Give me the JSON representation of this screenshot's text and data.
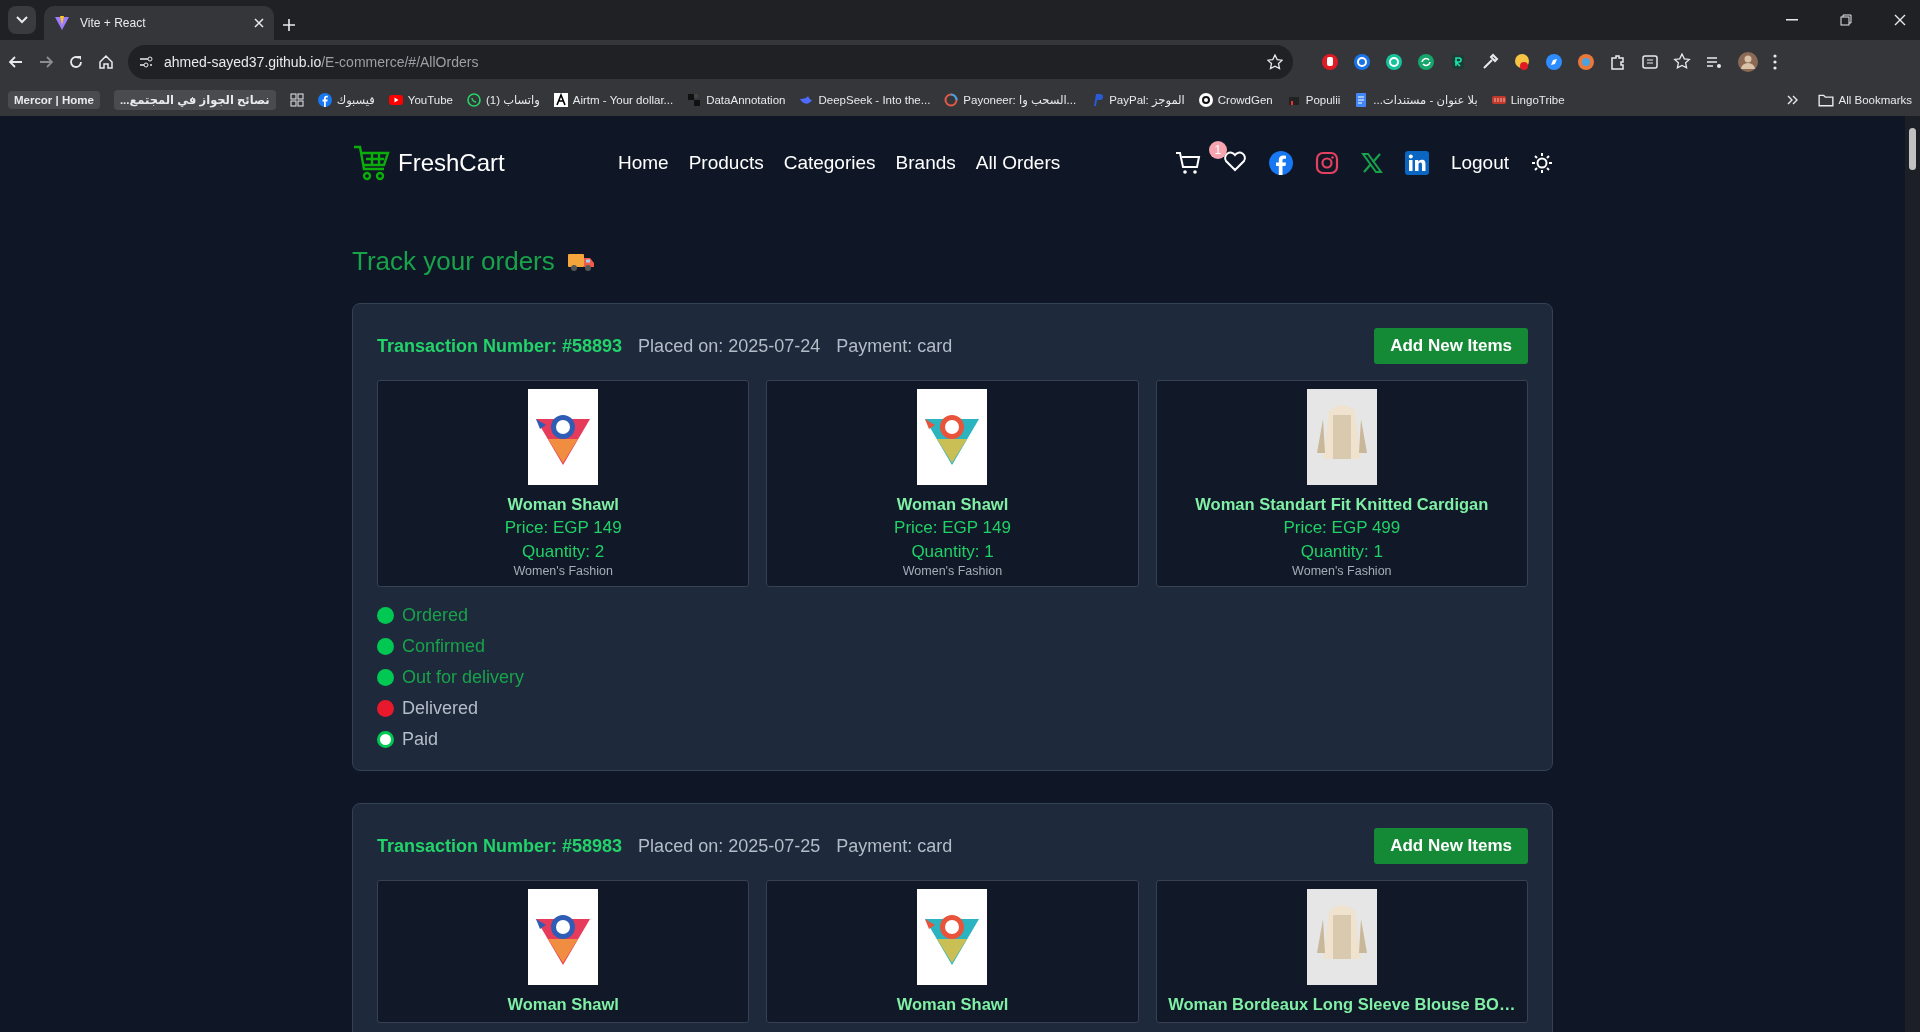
{
  "browser": {
    "tab_title": "Vite + React",
    "url_host": "ahmed-sayed37.github.io",
    "url_path": "/E-commerce/#/AllOrders",
    "bookmarks": [
      {
        "label": "Mercor | Home",
        "kind": "chip"
      },
      {
        "label": "نصائح الجواز في المجتمع...",
        "kind": "chip"
      },
      {
        "kind": "apps"
      },
      {
        "label": "فيسبوك",
        "kind": "facebook"
      },
      {
        "label": "YouTube",
        "kind": "youtube"
      },
      {
        "label": "واتساب (1)",
        "kind": "whatsapp"
      },
      {
        "label": "Airtm - Your dollar...",
        "kind": "airtm"
      },
      {
        "label": "DataAnnotation",
        "kind": "blocks"
      },
      {
        "label": "DeepSeek - Into the...",
        "kind": "deepseek"
      },
      {
        "label": "Payoneer: السحب وا...",
        "kind": "ring"
      },
      {
        "label": "PayPal: الموجز",
        "kind": "paypal"
      },
      {
        "label": "CrowdGen",
        "kind": "crowdgen"
      },
      {
        "label": "Populii",
        "kind": "populii"
      },
      {
        "label": "بلا عنوان - مستندات...",
        "kind": "doc"
      },
      {
        "label": "LingoTribe",
        "kind": "lingo"
      }
    ],
    "all_bookmarks": "All Bookmarks"
  },
  "navbar": {
    "brand": "FreshCart",
    "links": [
      "Home",
      "Products",
      "Categories",
      "Brands",
      "All Orders"
    ],
    "wishlist_count": "1",
    "logout": "Logout"
  },
  "page_title": "Track your orders",
  "orders": [
    {
      "transaction": "Transaction Number: #58893",
      "placed": "Placed on: 2025-07-24",
      "payment": "Payment: card",
      "button": "Add New Items",
      "items": [
        {
          "name": "Woman Shawl",
          "price": "Price: EGP 149",
          "quantity": "Quantity: 2",
          "category": "Women's Fashion"
        },
        {
          "name": "Woman Shawl",
          "price": "Price: EGP 149",
          "quantity": "Quantity: 1",
          "category": "Women's Fashion"
        },
        {
          "name": "Woman Standart Fit Knitted Cardigan",
          "price": "Price: EGP 499",
          "quantity": "Quantity: 1",
          "category": "Women's Fashion"
        }
      ],
      "statuses": [
        {
          "label": "Ordered",
          "done": true,
          "kind": "filled",
          "color": "#00c853"
        },
        {
          "label": "Confirmed",
          "done": true,
          "kind": "filled",
          "color": "#00c853"
        },
        {
          "label": "Out for delivery",
          "done": true,
          "kind": "filled",
          "color": "#00c853"
        },
        {
          "label": "Delivered",
          "done": false,
          "kind": "filled",
          "color": "#e8192c"
        },
        {
          "label": "Paid",
          "done": false,
          "kind": "ring",
          "color": "#ffffff"
        }
      ]
    },
    {
      "transaction": "Transaction Number: #58983",
      "placed": "Placed on: 2025-07-25",
      "payment": "Payment: card",
      "button": "Add New Items",
      "items": [
        {
          "name": "Woman Shawl"
        },
        {
          "name": "Woman Shawl"
        },
        {
          "name": "Woman Bordeaux Long Sleeve Blouse BO…"
        }
      ]
    }
  ]
}
